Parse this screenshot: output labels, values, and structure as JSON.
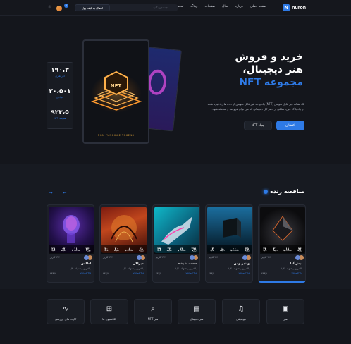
{
  "header": {
    "logo_letter": "N",
    "logo_text": "nuron",
    "nav": [
      "صفحه اصلی",
      "درباره",
      "مثال",
      "صفحات",
      "وبلاگ",
      "تماس"
    ],
    "search_placeholder": "جستجو بکنید",
    "wallet_button": "اتصال به کیف پول",
    "notification_count": "2"
  },
  "hero": {
    "title_line1": "خرید و فروش",
    "title_line2": "هنر دیجیتال،",
    "title_line3_accent": "مجموعه NFT",
    "description": "یک نشانه غیر قابل تعویض (NFT) یک واحد غیر قابل تعویض از داده های ذخیره شده در یک بلاک چین، شکلی از دفتر کل دیجیتالی که می توان فروخته و معامله شود.",
    "primary_button": "اکتشاف",
    "secondary_button": "ایجاد NFT",
    "card_title": "NFT",
    "card_caption": "NON FUNGIBLE TOKENS"
  },
  "stats": [
    {
      "value": "۱۹۰،۳",
      "label": "آثار هنری"
    },
    {
      "value": "۲۰،۵۰۱",
      "label": "حراجی"
    },
    {
      "value": "۹۲۳،۵",
      "label": "هنرمند NFT"
    }
  ],
  "auction": {
    "title": "مناقصه زنده",
    "prev_arrow": "←",
    "next_arrow": "→",
    "timer_labels": [
      "روزها",
      "ساعت ها",
      "دقیقه",
      "ثانیه"
    ],
    "cards": [
      {
        "name": "بیش آما",
        "bid": "بالاترین پیشنهاد ۱/۲۰",
        "price": "۰.۲۴۴wETH",
        "qty": "۲۴۳/۱",
        "likes": "۳۲۲ کاربر",
        "timer": [
          "۷۶",
          "۱۸",
          "۲۱",
          "۴۴"
        ]
      },
      {
        "name": "واندر ومن",
        "bid": "بالاترین پیشنهاد ۱/۲۰",
        "price": "۰.۲۴۴wETH",
        "qty": "۲۴۳/۱",
        "likes": "۳۲۲ کاربر",
        "timer": [
          "۳۵",
          "۰۰",
          "۱۸",
          "۱۳"
        ]
      },
      {
        "name": "دست شیشه",
        "bid": "بالاترین پیشنهاد ۱/۲۰",
        "price": "۰.۲۴۴wETH",
        "qty": "۲۴۳/۱",
        "likes": "۳۲۲ کاربر",
        "timer": [
          "۳۷۱",
          "۱۴",
          "۲۲",
          "۴۹"
        ]
      },
      {
        "name": "میراکل",
        "bid": "بالاترین پیشنهاد ۱/۲۰",
        "price": "۰.۲۴۴wETH",
        "qty": "۲۴۳/۱",
        "likes": "۳۲۲ کاربر",
        "timer": [
          "۲۸",
          "۱۸",
          "۲۰",
          "۴۰"
        ]
      },
      {
        "name": "اطلس",
        "bid": "بالاترین پیشنهاد ۱/۲۰",
        "price": "۰.۲۴۴wETH",
        "qty": "۲۴۳/۱",
        "likes": "۳۲۲ کاربر",
        "timer": [
          "۲۴۰",
          "۱۱",
          "۰۷",
          "۲۵"
        ]
      }
    ]
  },
  "categories": [
    {
      "icon": "image-icon",
      "label": "هنر"
    },
    {
      "icon": "music-icon",
      "label": "موسیقی"
    },
    {
      "icon": "map-icon",
      "label": "هنر دیجیتال"
    },
    {
      "icon": "search-icon",
      "label": "هنر NFT"
    },
    {
      "icon": "grid-icon",
      "label": "کلکسیون ها"
    },
    {
      "icon": "pulse-icon",
      "label": "کارت های ورزشی"
    }
  ],
  "colors": {
    "accent": "#2e7ae6",
    "background": "#14161c"
  }
}
